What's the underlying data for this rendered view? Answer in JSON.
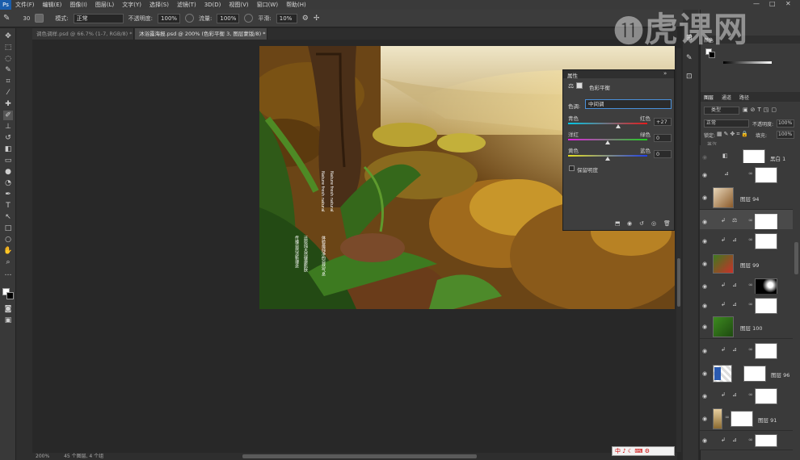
{
  "menubar": {
    "items": [
      "文件(F)",
      "编辑(E)",
      "图像(I)",
      "图层(L)",
      "文字(Y)",
      "选择(S)",
      "滤镜(T)",
      "3D(D)",
      "视图(V)",
      "窗口(W)",
      "帮助(H)"
    ],
    "window_controls": [
      "—",
      "□",
      "✕"
    ]
  },
  "options": {
    "brush_size": "30",
    "mode_label": "模式:",
    "mode_value": "正常",
    "opacity_label": "不透明度:",
    "opacity_value": "100%",
    "flow_label": "流量:",
    "flow_value": "100%",
    "smooth_label": "平滑:",
    "smooth_value": "10%"
  },
  "tabs": [
    {
      "label": "调色调样.psd @ 66.7% (1-7, RGB/8) *"
    },
    {
      "label": "沐浴露海报.psd @ 200% (色彩平衡 3, 图层蒙版/8) *"
    }
  ],
  "statusbar": {
    "zoom": "200%",
    "info": "45 个图层, 4 个组"
  },
  "poster_text": {
    "col1": "Nature fresh natural",
    "col2": "Nature fresh natural",
    "vcol1": "传播自然清新理念",
    "vcol2": "还原纯天然健康肌肤",
    "vcol3": "体验最纯净的自然气息"
  },
  "properties": {
    "header": "属性",
    "title": "色彩平衡",
    "tone_label": "色调:",
    "tone_value": "中间调",
    "sliders": [
      {
        "left": "青色",
        "right": "红色",
        "value": "+27",
        "level": 0.635
      },
      {
        "left": "洋红",
        "right": "绿色",
        "value": "0",
        "level": 0.5
      },
      {
        "left": "黄色",
        "right": "蓝色",
        "value": "0",
        "level": 0.5
      }
    ],
    "preserve_luminosity": "保留明度"
  },
  "right_panel": {
    "histogram_tab": "颜色",
    "histogram_tab2": "色板",
    "layers_tabs": [
      "图层",
      "通道",
      "路径"
    ],
    "kind_label": "类型",
    "blend_mode": "正常",
    "opacity_label": "不透明度:",
    "opacity_value": "100%",
    "lock_label": "锁定:",
    "fill_label": "填充:",
    "fill_value": "100%",
    "group_name": "蒸汽",
    "layers": [
      {
        "name": "黑白 1"
      },
      {
        "name": ""
      },
      {
        "name": "图层 94"
      },
      {
        "name": ""
      },
      {
        "name": ""
      },
      {
        "name": "图层 99"
      },
      {
        "name": ""
      },
      {
        "name": ""
      },
      {
        "name": "图层 100"
      },
      {
        "name": ""
      },
      {
        "name": "图层 96"
      },
      {
        "name": ""
      },
      {
        "name": "图层 91"
      },
      {
        "name": ""
      }
    ]
  },
  "watermark": "虎课网",
  "ime": "中 ♪ ☾ ⌨ ⚙"
}
